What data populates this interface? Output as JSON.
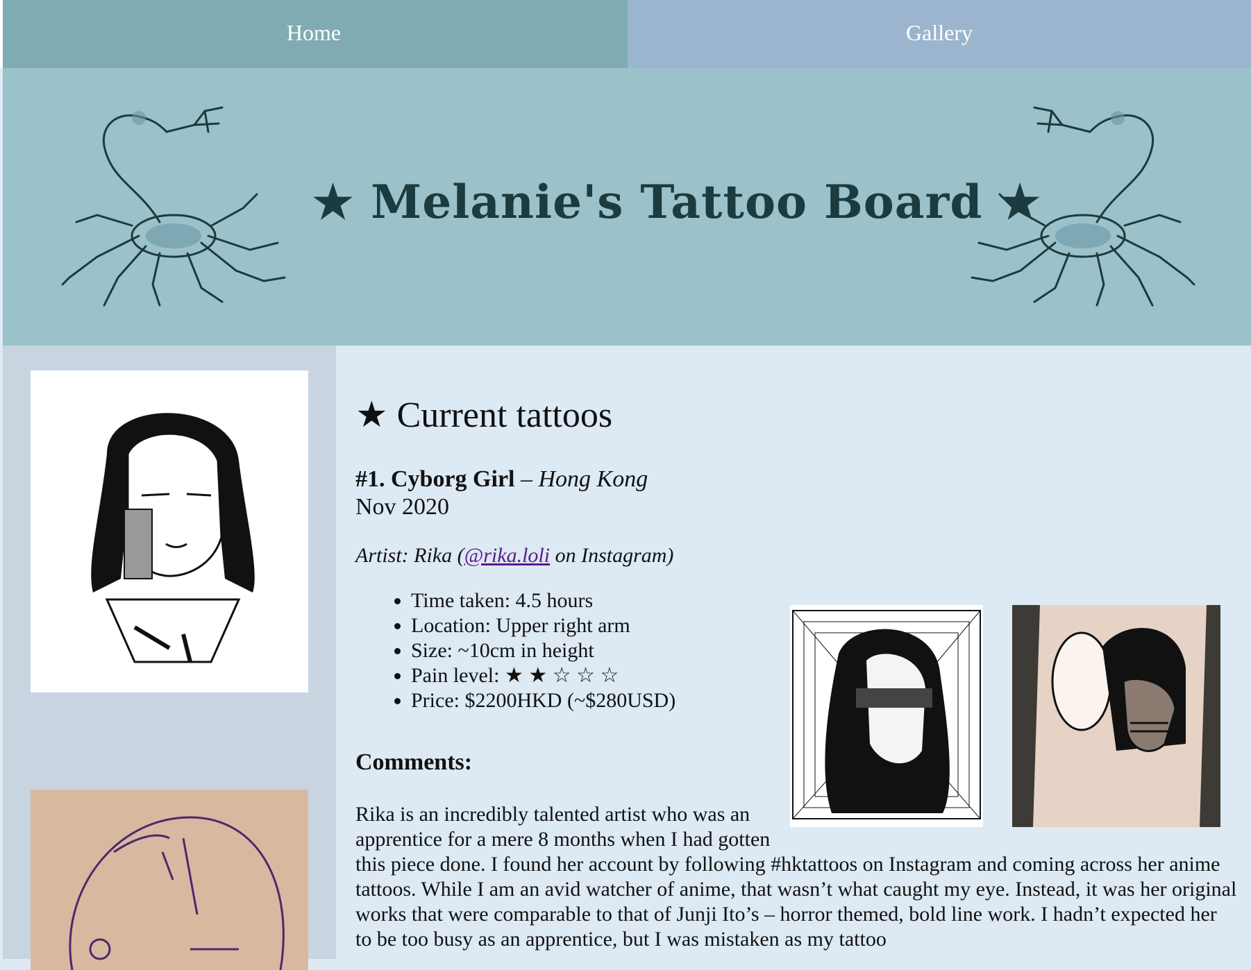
{
  "nav": {
    "home": "Home",
    "gallery": "Gallery"
  },
  "header": {
    "title": "★ Melanie's Tattoo Board ★"
  },
  "main": {
    "heading": "★ Current tattoos",
    "entry": {
      "number_title": "#1. Cyborg Girl",
      "dash": " – ",
      "location": "Hong Kong",
      "date": "Nov 2020",
      "artist_prefix": "Artist: Rika (",
      "artist_handle": "@rika.loli",
      "artist_suffix": " on Instagram)",
      "facts": [
        "Time taken: 4.5 hours",
        "Location: Upper right arm",
        "Size: ~10cm in height",
        "Pain level: ★ ★ ☆ ☆ ☆",
        "Price: $2200HKD (~$280USD)"
      ],
      "comments_heading": "Comments:",
      "comment_text": "Rika is an incredibly talented artist who was an apprentice for a mere 8 months when I had gotten this piece done. I found her account by following #hktattoos on Instagram and coming across her anime tattoos. While I am an avid watcher of anime, that wasn’t what caught my eye. Instead, it was her original works that were comparable to that of Junji Ito’s – horror themed, bold line work. I hadn’t expected her to be too busy as an apprentice, but I was mistaken as my tattoo"
    }
  },
  "colors": {
    "nav_home": "#80abb3",
    "nav_gallery": "#9bb5ce",
    "banner": "#9bc1ca",
    "sidebar": "#c8d5e1",
    "content": "#dde9f3",
    "title": "#1b3b3e",
    "link": "#5b1a8a"
  }
}
